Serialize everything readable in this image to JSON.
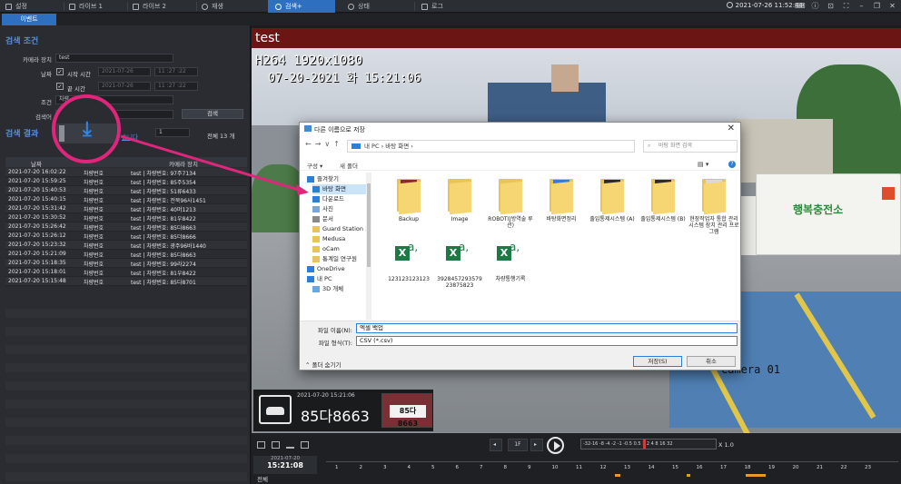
{
  "topbar": {
    "tabs": [
      {
        "label": "설정",
        "icon": "gear-icon"
      },
      {
        "label": "라이브 1",
        "icon": "monitor-icon"
      },
      {
        "label": "라이브 2",
        "icon": "monitor-icon"
      },
      {
        "label": "재생",
        "icon": "play-icon"
      },
      {
        "label": "검색+",
        "icon": "search-icon"
      },
      {
        "label": "상태",
        "icon": "check-circle-icon"
      },
      {
        "label": "로그",
        "icon": "log-icon"
      }
    ],
    "clock": "2021-07-26 11:52:44"
  },
  "subtab": {
    "label": "이벤트"
  },
  "search": {
    "title": "검색 조건",
    "camera_label": "카메라 장치",
    "camera_value": "test",
    "date_label": "날짜",
    "start_label": "시작 시간",
    "start_date": "2021-07-26",
    "start_time": "11 :27 :22",
    "end_label": "끝 시간",
    "end_date": "2021-07-26",
    "end_time": "11 :27 :22",
    "condition_label": "조건",
    "condition_value": "차량",
    "keyword_label": "검색어",
    "search_button": "검색"
  },
  "results": {
    "title": "검색 결과",
    "link_fragment": "습니다",
    "page_value": "1",
    "total": "전체  13 개",
    "col_date": "날짜",
    "col_camera": "카메라 장치",
    "rows": [
      {
        "date": "2021-07-20 16:02:22",
        "type": "차량번호",
        "camera": "test | 차량번호: 97주7134"
      },
      {
        "date": "2021-07-20 15:59:25",
        "type": "차량번호",
        "camera": "test | 차량번호: 85주5354"
      },
      {
        "date": "2021-07-20 15:40:53",
        "type": "차량번호",
        "camera": "test | 차량번호: 51류6433"
      },
      {
        "date": "2021-07-20 15:40:15",
        "type": "차량번호",
        "camera": "test | 차량번호: 전북96사1451"
      },
      {
        "date": "2021-07-20 15:31:42",
        "type": "차량번호",
        "camera": "test | 차량번호: 40머1213"
      },
      {
        "date": "2021-07-20 15:30:52",
        "type": "차량번호",
        "camera": "test | 차량번호: 81우8422"
      },
      {
        "date": "2021-07-20 15:26:42",
        "type": "차량번호",
        "camera": "test | 차량번호: 85다8663"
      },
      {
        "date": "2021-07-20 15:26:12",
        "type": "차량번호",
        "camera": "test | 차량번호: 85더8666"
      },
      {
        "date": "2021-07-20 15:23:32",
        "type": "차량번호",
        "camera": "test | 차량번호: 광주96바1440"
      },
      {
        "date": "2021-07-20 15:21:09",
        "type": "차량번호",
        "camera": "test | 차량번호: 85다8663"
      },
      {
        "date": "2021-07-20 15:18:35",
        "type": "차량번호",
        "camera": "test | 차량번호: 99라2274"
      },
      {
        "date": "2021-07-20 15:18:01",
        "type": "차량번호",
        "camera": "test | 차량번호: 81우8422"
      },
      {
        "date": "2021-07-20 15:15:48",
        "type": "차량번호",
        "camera": "test | 차량번호: 85다8701"
      }
    ]
  },
  "video": {
    "title": "test",
    "codec": "H264 1920x1080",
    "timestamp": "07-20-2021 화 15:21:06",
    "camera_label": "Camera 01",
    "plate_number": "85다8663",
    "plate_date": "2021-07-20 15:21:06",
    "plate_thumb_text": "85다8663"
  },
  "controls": {
    "speed_value": "1F",
    "speed_scale": "-32-16 -8 -4 -2 -1 -0.5 0.5 1 2 4 8 16 32",
    "speed_display": "X 1.0",
    "date_small": "2021-07-20",
    "time_big": "15:21:08",
    "all_label": "전체",
    "timeline_ticks": [
      "1",
      "2",
      "3",
      "4",
      "5",
      "6",
      "7",
      "8",
      "9",
      "10",
      "11",
      "12",
      "13",
      "14",
      "15",
      "16",
      "17",
      "18",
      "19",
      "20",
      "21",
      "22",
      "23"
    ]
  },
  "dialog": {
    "title": "다른 이름으로 저장",
    "breadcrumb": "내 PC  ›  바탕 화면  ›",
    "search_placeholder": "바탕 화면 검색",
    "organize": "구성 ▾",
    "new_folder": "새 폴더",
    "tree": [
      {
        "label": "즐겨찾기",
        "icon": "star-icon"
      },
      {
        "label": "바탕 화면",
        "icon": "desktop-icon",
        "selected": true
      },
      {
        "label": "다운로드",
        "icon": "download-icon"
      },
      {
        "label": "사진",
        "icon": "image-icon"
      },
      {
        "label": "문서",
        "icon": "document-icon"
      },
      {
        "label": "Guard Station 3",
        "icon": "folder-icon"
      },
      {
        "label": "Medusa",
        "icon": "folder-icon"
      },
      {
        "label": "oCam",
        "icon": "folder-icon"
      },
      {
        "label": "통계일 연구원",
        "icon": "folder-icon"
      },
      {
        "label": "OneDrive",
        "icon": "cloud-icon"
      },
      {
        "label": "내 PC",
        "icon": "pc-icon"
      },
      {
        "label": "3D 개체",
        "icon": "cube-icon"
      }
    ],
    "files": [
      {
        "name": "Backup",
        "kind": "folder"
      },
      {
        "name": "Image",
        "kind": "folder"
      },
      {
        "name": "ROBOT(J방역술 루션)",
        "kind": "folder"
      },
      {
        "name": "바탕화면정리",
        "kind": "folder"
      },
      {
        "name": "출입통제시스템 (A)",
        "kind": "folder"
      },
      {
        "name": "출입통제시스템 (B)",
        "kind": "folder"
      },
      {
        "name": "현장작업자 통합 관리 시스템 장치 관리 프로그램",
        "kind": "folder"
      },
      {
        "name": "123123123123",
        "kind": "excel"
      },
      {
        "name": "3928457293579 23875823",
        "kind": "excel"
      },
      {
        "name": "차량통행기록",
        "kind": "excel"
      }
    ],
    "filename_label": "파일 이름(N):",
    "filename_value": "엑셀 백업",
    "filetype_label": "파일 형식(T):",
    "filetype_value": "CSV (*.csv)",
    "hide_folders": "폴더 숨기기",
    "save_button": "저장(S)",
    "cancel_button": "취소"
  },
  "colors": {
    "accent": "#2f6fbf",
    "highlight": "#e0267c",
    "video_title_bar": "#6b1515"
  }
}
